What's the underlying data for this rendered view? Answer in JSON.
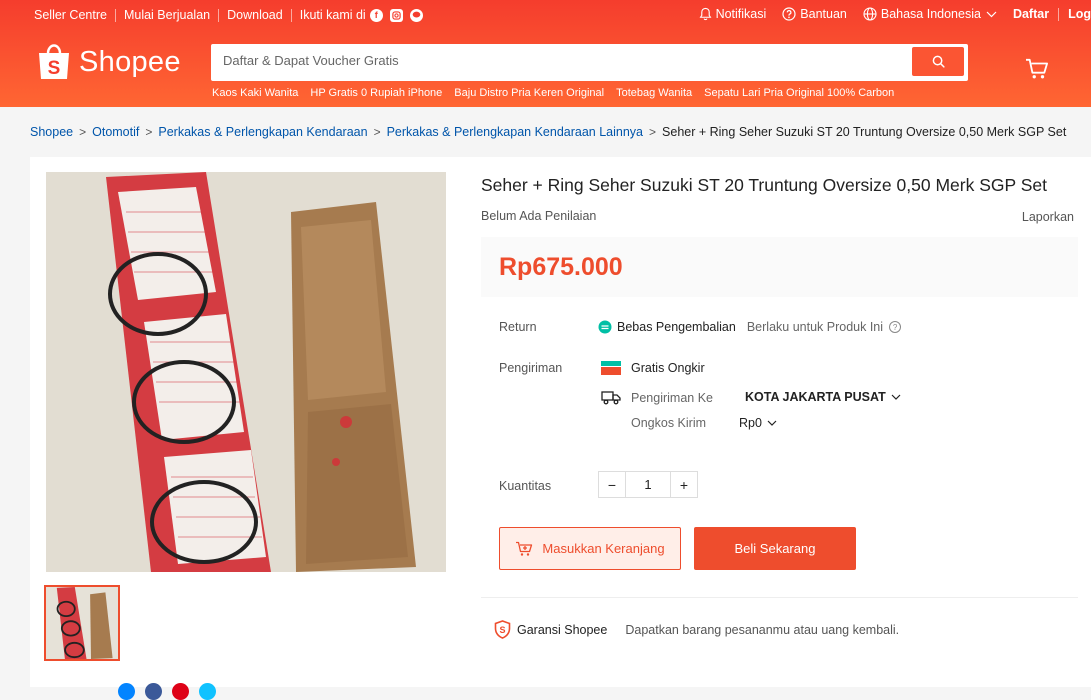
{
  "colors": {
    "brand": "#ee4d2d",
    "header_start": "#f53d2d",
    "header_end": "#ff6633",
    "link": "#0055aa"
  },
  "topbar": {
    "seller_centre": "Seller Centre",
    "start_selling": "Mulai Berjualan",
    "download": "Download",
    "follow_us": "Ikuti kami di",
    "notifications": "Notifikasi",
    "help": "Bantuan",
    "language": "Bahasa Indonesia",
    "register": "Daftar",
    "login": "Log"
  },
  "header": {
    "logo_text": "Shopee",
    "search_placeholder": "Daftar & Dapat Voucher Gratis",
    "search_hints": [
      "Kaos Kaki Wanita",
      "HP Gratis 0 Rupiah iPhone",
      "Baju Distro Pria Keren Original",
      "Totebag Wanita",
      "Sepatu Lari Pria Original 100% Carbon"
    ]
  },
  "breadcrumb": [
    "Shopee",
    "Otomotif",
    "Perkakas & Perlengkapan Kendaraan",
    "Perkakas & Perlengkapan Kendaraan Lainnya",
    "Seher + Ring Seher Suzuki ST 20 Truntung Oversize 0,50 Merk SGP Set"
  ],
  "product": {
    "title": "Seher + Ring Seher Suzuki ST 20 Truntung Oversize 0,50 Merk SGP Set",
    "rating_text": "Belum Ada Penilaian",
    "report": "Laporkan",
    "price": "Rp675.000",
    "return_label": "Return",
    "return_value": "Bebas Pengembalian",
    "return_note": "Berlaku untuk Produk Ini",
    "shipping_label": "Pengiriman",
    "free_shipping": "Gratis Ongkir",
    "ship_to_label": "Pengiriman Ke",
    "ship_to_value": "KOTA JAKARTA PUSAT",
    "ship_cost_label": "Ongkos Kirim",
    "ship_cost_value": "Rp0",
    "quantity_label": "Kuantitas",
    "quantity": "1",
    "qty_minus": "−",
    "qty_plus": "+",
    "add_to_cart": "Masukkan Keranjang",
    "buy_now": "Beli Sekarang",
    "guarantee_title": "Garansi Shopee",
    "guarantee_desc": "Dapatkan barang pesananmu atau uang kembali."
  }
}
